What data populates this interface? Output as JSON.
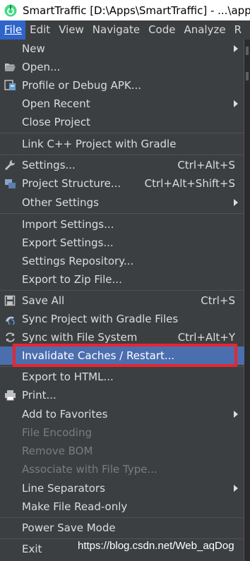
{
  "window": {
    "title": "SmartTraffic [D:\\Apps\\SmartTraffic] - ...\\app\\s",
    "app_icon": "android-studio-icon"
  },
  "menubar": {
    "items": [
      {
        "label": "File",
        "active": true
      },
      {
        "label": "Edit"
      },
      {
        "label": "View"
      },
      {
        "label": "Navigate"
      },
      {
        "label": "Code"
      },
      {
        "label": "Analyze"
      },
      {
        "label": "R"
      }
    ]
  },
  "file_menu": {
    "items": [
      {
        "label": "New",
        "submenu": true
      },
      {
        "label": "Open...",
        "icon": "folder-open-icon"
      },
      {
        "label": "Profile or Debug APK...",
        "icon": "profile-apk-icon"
      },
      {
        "label": "Open Recent",
        "submenu": true
      },
      {
        "label": "Close Project"
      },
      {
        "label": "Link C++ Project with Gradle"
      },
      {
        "label": "Settings...",
        "shortcut": "Ctrl+Alt+S",
        "icon": "wrench-icon"
      },
      {
        "label": "Project Structure...",
        "shortcut": "Ctrl+Alt+Shift+S",
        "icon": "project-structure-icon"
      },
      {
        "label": "Other Settings",
        "submenu": true
      },
      {
        "label": "Import Settings..."
      },
      {
        "label": "Export Settings..."
      },
      {
        "label": "Settings Repository..."
      },
      {
        "label": "Export to Zip File..."
      },
      {
        "label": "Save All",
        "shortcut": "Ctrl+S",
        "icon": "save-icon"
      },
      {
        "label": "Sync Project with Gradle Files",
        "icon": "gradle-sync-icon"
      },
      {
        "label": "Sync with File System",
        "shortcut": "Ctrl+Alt+Y",
        "icon": "sync-icon"
      },
      {
        "label": "Invalidate Caches / Restart...",
        "selected": true
      },
      {
        "label": "Export to HTML..."
      },
      {
        "label": "Print...",
        "icon": "print-icon"
      },
      {
        "label": "Add to Favorites",
        "submenu": true
      },
      {
        "label": "File Encoding",
        "disabled": true
      },
      {
        "label": "Remove BOM",
        "disabled": true
      },
      {
        "label": "Associate with File Type...",
        "disabled": true
      },
      {
        "label": "Line Separators",
        "submenu": true
      },
      {
        "label": "Make File Read-only"
      },
      {
        "label": "Power Save Mode"
      },
      {
        "label": "Exit"
      }
    ]
  },
  "watermark": "https://blog.csdn.net/Web_aqDog",
  "colors": {
    "menu_bg": "#3c3f41",
    "selected_bg": "#4b6eaf",
    "active_menu_bg": "#2f65ca",
    "highlight_border": "#e8262f",
    "disabled_text": "#7a7c7e"
  }
}
